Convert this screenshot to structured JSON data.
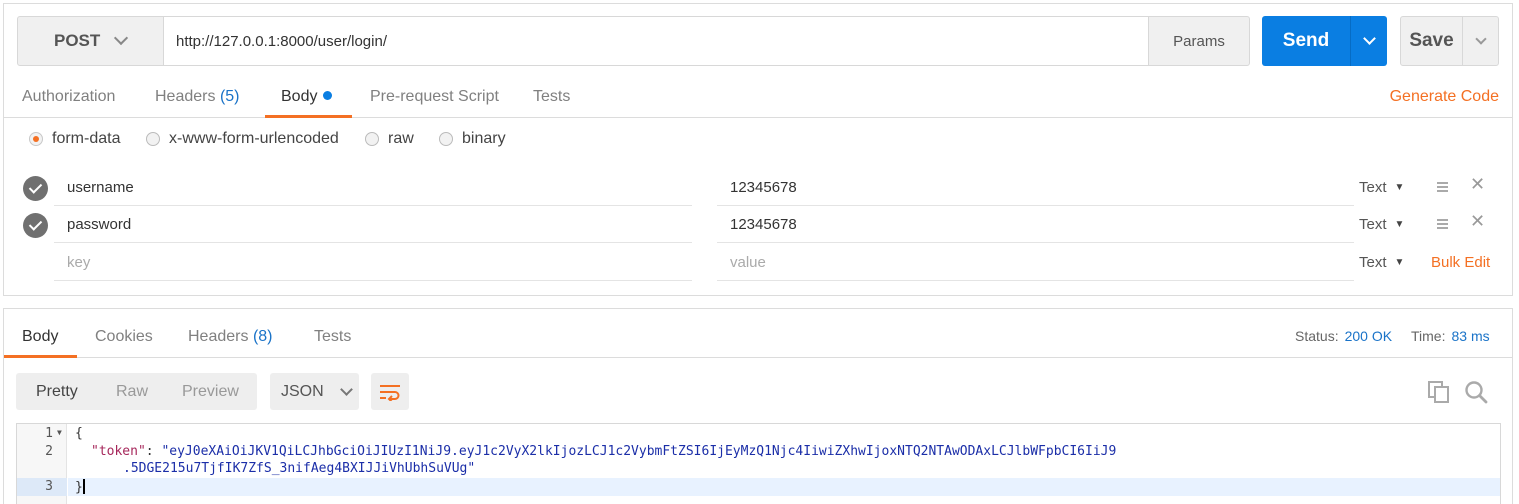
{
  "request": {
    "method": "POST",
    "url": "http://127.0.0.1:8000/user/login/",
    "params_label": "Params",
    "send_label": "Send",
    "save_label": "Save"
  },
  "request_tabs": {
    "authorization": "Authorization",
    "headers": "Headers",
    "headers_count": "(5)",
    "body": "Body",
    "prerequest": "Pre-request Script",
    "tests": "Tests",
    "generate_code": "Generate Code"
  },
  "body_modes": {
    "form_data": "form-data",
    "urlencoded": "x-www-form-urlencoded",
    "raw": "raw",
    "binary": "binary",
    "selected": "form-data"
  },
  "form_rows": [
    {
      "key": "username",
      "value": "12345678",
      "type": "Text",
      "checked": true
    },
    {
      "key": "password",
      "value": "12345678",
      "type": "Text",
      "checked": true
    }
  ],
  "new_row": {
    "key_placeholder": "key",
    "value_placeholder": "value",
    "type": "Text",
    "bulk_edit": "Bulk Edit"
  },
  "response_tabs": {
    "body": "Body",
    "cookies": "Cookies",
    "headers": "Headers",
    "headers_count": "(8)",
    "tests": "Tests"
  },
  "response_status": {
    "status_label": "Status:",
    "status_value": "200 OK",
    "time_label": "Time:",
    "time_value": "83 ms"
  },
  "response_view": {
    "pretty": "Pretty",
    "raw": "Raw",
    "preview": "Preview",
    "format": "JSON"
  },
  "response_body": {
    "line_numbers": [
      "1",
      "2",
      "3"
    ],
    "open_brace": "{",
    "key": "\"token\"",
    "colon": ": ",
    "value_part1": "\"eyJ0eXAiOiJKV1QiLCJhbGciOiJIUzI1NiJ9.eyJ1c2VyX2lkIjozLCJ1c2VybmFtZSI6IjEyMzQ1Njc4IiwiZXhwIjoxNTQ2NTAwODAxLCJlbWFpbCI6IiJ9",
    "value_part2": ".5DGE215u7TjfIK7ZfS_3nifAeg4BXIJJiVhUbhSuVUg\"",
    "close_brace": "}"
  },
  "icons": {
    "method_dropdown": "chevron-down-icon",
    "send_dropdown": "chevron-down-icon",
    "save_dropdown": "chevron-down-icon",
    "check": "check-circle-icon",
    "reorder": "hamburger-icon",
    "delete": "close-icon",
    "wrap": "wrap-lines-icon",
    "copy": "copy-icon",
    "search": "search-icon"
  },
  "colors": {
    "accent": "#f47023",
    "primary": "#0a7ee2",
    "link": "#1a73c8"
  }
}
